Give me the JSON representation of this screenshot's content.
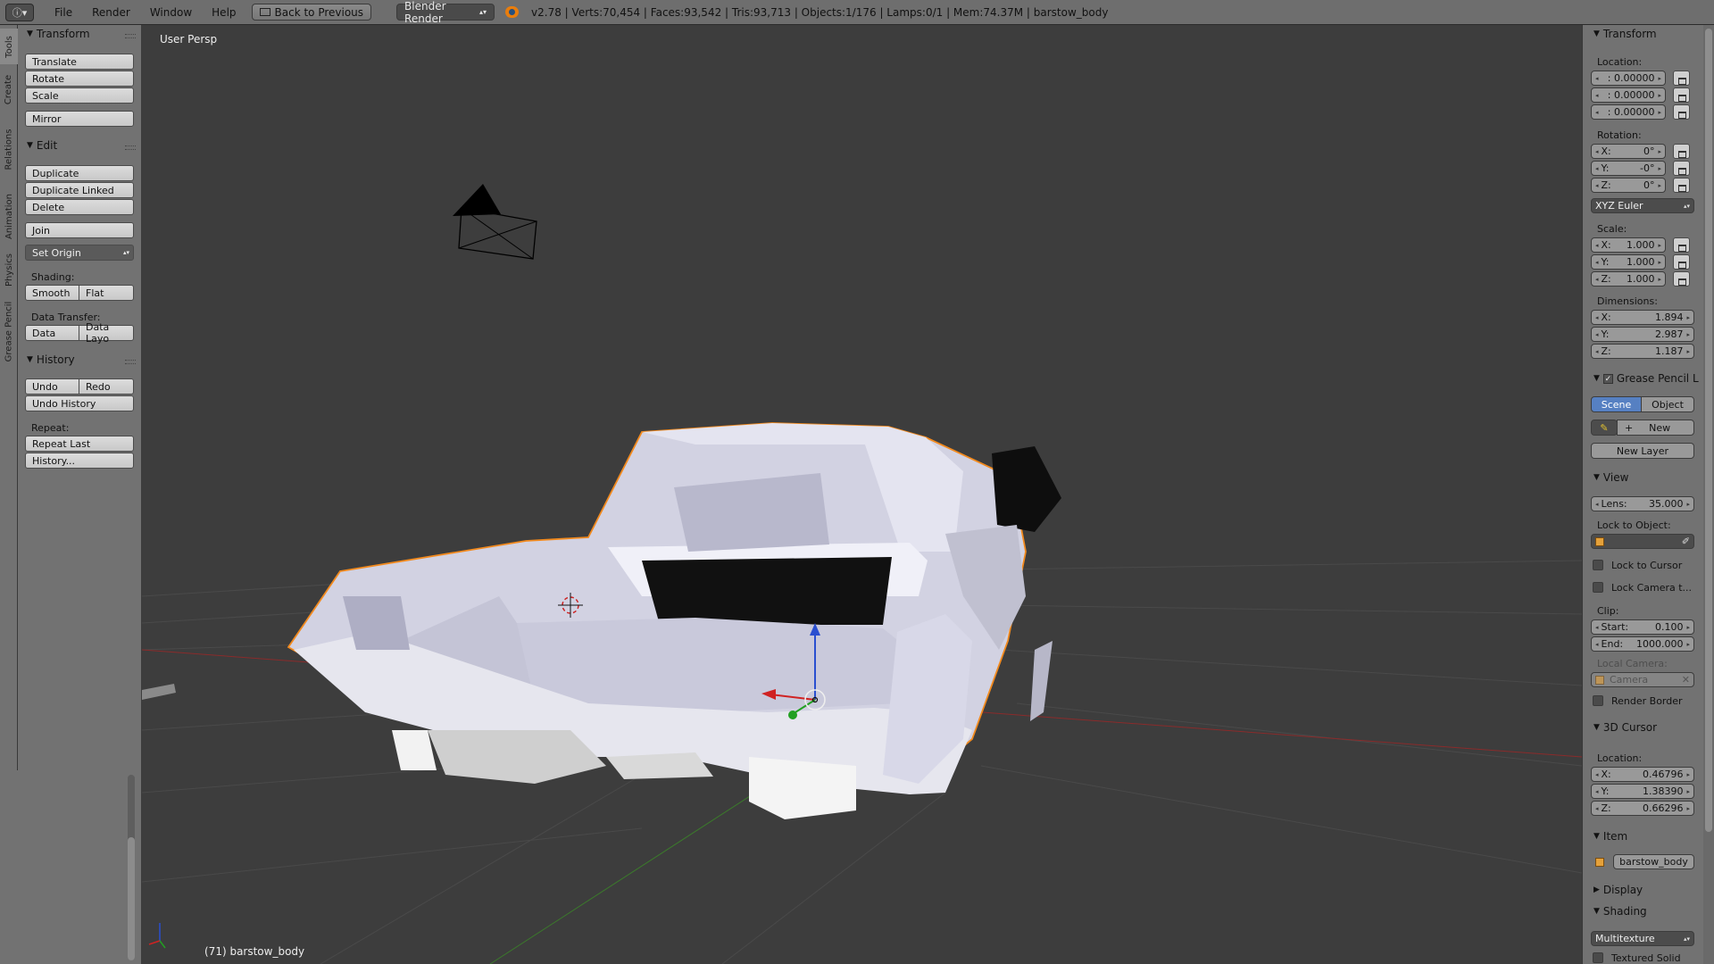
{
  "topbar": {
    "editor_icon": "info-icon",
    "menus": [
      "File",
      "Render",
      "Window",
      "Help"
    ],
    "back_button": "Back to Previous",
    "render_engine": "Blender Render",
    "stats": "v2.78 | Verts:70,454 | Faces:93,542 | Tris:93,713 | Objects:1/176 | Lamps:0/1 | Mem:74.37M | barstow_body"
  },
  "left_tabs": [
    "Tools",
    "Create",
    "Relations",
    "Animation",
    "Physics",
    "Grease Pencil"
  ],
  "tool_panel": {
    "transform": {
      "header": "Transform",
      "buttons": [
        "Translate",
        "Rotate",
        "Scale",
        "Mirror"
      ]
    },
    "edit": {
      "header": "Edit",
      "buttons": [
        "Duplicate",
        "Duplicate Linked",
        "Delete",
        "Join"
      ],
      "set_origin": "Set Origin",
      "shading_label": "Shading:",
      "smooth": "Smooth",
      "flat": "Flat",
      "data_transfer_label": "Data Transfer:",
      "data": "Data",
      "data_layout": "Data Layo"
    },
    "history": {
      "header": "History",
      "undo": "Undo",
      "redo": "Redo",
      "undo_history": "Undo History",
      "repeat_label": "Repeat:",
      "repeat_last": "Repeat Last",
      "history_more": "History..."
    }
  },
  "viewport": {
    "view_name": "User Persp",
    "object_label": "(71) barstow_body",
    "body_color": "#dcdcea",
    "selection_outline": "#f28a1e"
  },
  "properties": {
    "transform": {
      "header": "Transform",
      "location_label": "Location:",
      "location": [
        ": 0.00000",
        ": 0.00000",
        ": 0.00000"
      ],
      "rotation_label": "Rotation:",
      "rotation": [
        {
          "axis": "X:",
          "value": "0°"
        },
        {
          "axis": "Y:",
          "value": "-0°"
        },
        {
          "axis": "Z:",
          "value": "0°"
        }
      ],
      "rotation_mode": "XYZ Euler",
      "scale_label": "Scale:",
      "scale": [
        {
          "axis": "X:",
          "value": "1.000"
        },
        {
          "axis": "Y:",
          "value": "1.000"
        },
        {
          "axis": "Z:",
          "value": "1.000"
        }
      ],
      "dimensions_label": "Dimensions:",
      "dimensions": [
        {
          "axis": "X:",
          "value": "1.894"
        },
        {
          "axis": "Y:",
          "value": "2.987"
        },
        {
          "axis": "Z:",
          "value": "1.187"
        }
      ]
    },
    "grease_pencil": {
      "header": "Grease Pencil L",
      "scene": "Scene",
      "object": "Object",
      "new": "New",
      "new_layer": "New Layer"
    },
    "view": {
      "header": "View",
      "lens_label": "Lens:",
      "lens": "35.000",
      "lock_to_object_label": "Lock to Object:",
      "lock_to_cursor": "Lock to Cursor",
      "lock_camera": "Lock Camera t...",
      "clip_label": "Clip:",
      "start_label": "Start:",
      "start": "0.100",
      "end_label": "End:",
      "end": "1000.000",
      "local_camera_label": "Local Camera:",
      "camera": "Camera",
      "render_border": "Render Border"
    },
    "cursor": {
      "header": "3D Cursor",
      "location_label": "Location:",
      "location": [
        {
          "axis": "X:",
          "value": "0.46796"
        },
        {
          "axis": "Y:",
          "value": "1.38390"
        },
        {
          "axis": "Z:",
          "value": "0.66296"
        }
      ]
    },
    "item": {
      "header": "Item",
      "name": "barstow_body"
    },
    "display": {
      "header": "Display"
    },
    "shading": {
      "header": "Shading",
      "mode": "Multitexture",
      "textured_solid": "Textured Solid"
    }
  }
}
